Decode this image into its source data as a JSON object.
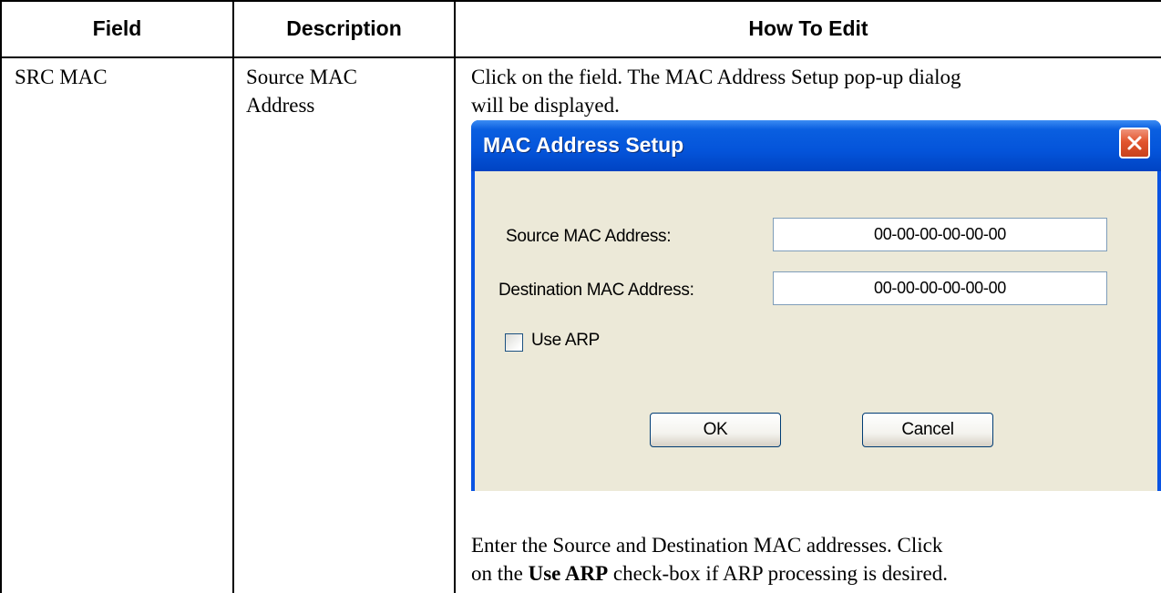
{
  "table": {
    "headers": {
      "field": "Field",
      "description": "Description",
      "how_to_edit": "How To Edit"
    },
    "row": {
      "field": "SRC MAC",
      "description_line1": "Source MAC",
      "description_line2": "Address",
      "edit_intro_line1": "Click on the field. The MAC Address Setup pop-up dialog",
      "edit_intro_line2": "will be displayed.",
      "edit_after_line1": "Enter the Source and Destination MAC addresses. Click",
      "edit_after_line2_pre": "on the ",
      "edit_after_line2_bold": "Use ARP",
      "edit_after_line2_post": " check-box if ARP processing is desired."
    }
  },
  "dialog": {
    "title": "MAC Address Setup",
    "source_label": "Source MAC Address:",
    "source_value": "00-00-00-00-00-00",
    "destination_label": "Destination MAC Address:",
    "destination_value": "00-00-00-00-00-00",
    "use_arp_label": "Use ARP",
    "use_arp_checked": false,
    "ok_label": "OK",
    "cancel_label": "Cancel",
    "close_icon": "close-icon"
  }
}
